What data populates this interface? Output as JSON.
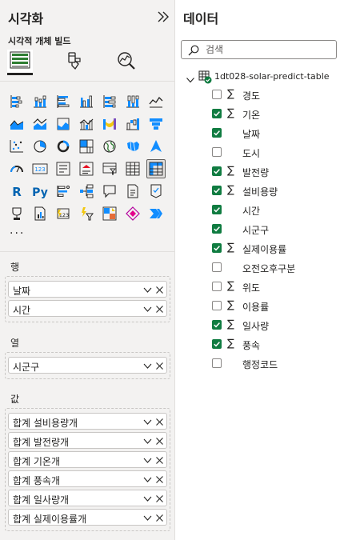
{
  "viz_pane": {
    "title": "시각화",
    "build_label": "시각적 개체 빌드",
    "more": "···",
    "wells": {
      "rows": {
        "label": "행",
        "fields": [
          "날짜",
          "시간"
        ]
      },
      "columns": {
        "label": "열",
        "fields": [
          "시군구"
        ]
      },
      "values": {
        "label": "값",
        "fields": [
          "합계 설비용량개",
          "합계 발전량개",
          "합계 기온개",
          "합계 풍속개",
          "합계 일사량개",
          "합계 실제이용률개"
        ]
      }
    }
  },
  "data_pane": {
    "title": "데이터",
    "search": {
      "placeholder": "검색",
      "value": ""
    },
    "table": {
      "name": "1dt028-solar-predict-table",
      "fields": [
        {
          "name": "경도",
          "checked": false,
          "sigma": true
        },
        {
          "name": "기온",
          "checked": true,
          "sigma": true
        },
        {
          "name": "날짜",
          "checked": true,
          "sigma": false
        },
        {
          "name": "도시",
          "checked": false,
          "sigma": false
        },
        {
          "name": "발전량",
          "checked": true,
          "sigma": true
        },
        {
          "name": "설비용량",
          "checked": true,
          "sigma": true
        },
        {
          "name": "시간",
          "checked": true,
          "sigma": false
        },
        {
          "name": "시군구",
          "checked": true,
          "sigma": false
        },
        {
          "name": "실제이용률",
          "checked": true,
          "sigma": true
        },
        {
          "name": "오전오후구분",
          "checked": false,
          "sigma": false
        },
        {
          "name": "위도",
          "checked": false,
          "sigma": true
        },
        {
          "name": "이용률",
          "checked": false,
          "sigma": true
        },
        {
          "name": "일사량",
          "checked": true,
          "sigma": true
        },
        {
          "name": "풍속",
          "checked": true,
          "sigma": true
        },
        {
          "name": "행정코드",
          "checked": false,
          "sigma": false
        }
      ]
    }
  },
  "visual_icons": [
    "stacked-bar-chart-icon",
    "stacked-column-chart-icon",
    "clustered-bar-chart-icon",
    "clustered-column-chart-icon",
    "100-stacked-bar-chart-icon",
    "100-stacked-column-chart-icon",
    "line-chart-icon",
    "area-chart-icon",
    "stacked-area-chart-icon",
    "line-stacked-column-chart-icon",
    "line-clustered-column-chart-icon",
    "ribbon-chart-icon",
    "waterfall-chart-icon",
    "funnel-chart-icon",
    "scatter-chart-icon",
    "pie-chart-icon",
    "donut-chart-icon",
    "treemap-icon",
    "map-icon",
    "filled-map-icon",
    "azure-map-icon",
    "gauge-icon",
    "card-icon",
    "multi-row-card-icon",
    "kpi-icon",
    "slicer-icon",
    "table-icon",
    "matrix-icon",
    "r-visual-icon",
    "python-visual-icon",
    "key-influencers-icon",
    "decomposition-tree-icon",
    "qa-icon",
    "paginated-report-icon",
    "metrics-icon",
    "card-new-icon",
    "power-apps-icon",
    "power-automate-icon",
    "smart-narrative-icon",
    "multi-field-icon",
    "arrow-visual-icon",
    "more-visuals-icon"
  ],
  "colors": {
    "pane_bg": "#f3f2f1",
    "checked_green": "#107c41",
    "accent_blue": "#118dff",
    "text": "#252423"
  }
}
